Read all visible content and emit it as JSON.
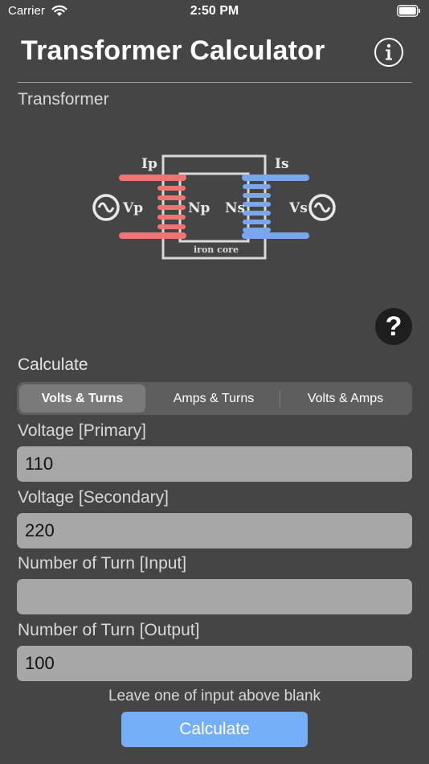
{
  "status_bar": {
    "carrier": "Carrier",
    "time": "2:50 PM"
  },
  "header": {
    "title": "Transformer Calculator"
  },
  "transformer_section": {
    "label": "Transformer",
    "diagram": {
      "ip": "Ip",
      "is": "Is",
      "vp": "Vp",
      "vs": "Vs",
      "np": "Np",
      "ns": "Ns",
      "core": "iron core"
    }
  },
  "calculate_section": {
    "label": "Calculate",
    "tabs": [
      "Volts & Turns",
      "Amps & Turns",
      "Volts & Amps"
    ],
    "selected_tab": "Volts & Turns"
  },
  "fields": [
    {
      "label": "Voltage [Primary]",
      "value": "110"
    },
    {
      "label": "Voltage [Secondary]",
      "value": "220"
    },
    {
      "label": "Number of Turn [Input]",
      "value": ""
    },
    {
      "label": "Number of Turn [Output]",
      "value": "100"
    }
  ],
  "hint": "Leave one of input above blank",
  "calculate_button": "Calculate",
  "help_button": "?",
  "colors": {
    "background": "#454545",
    "primary_coil": "#f07474",
    "secondary_coil": "#7aa6f0",
    "button": "#74aef6"
  }
}
